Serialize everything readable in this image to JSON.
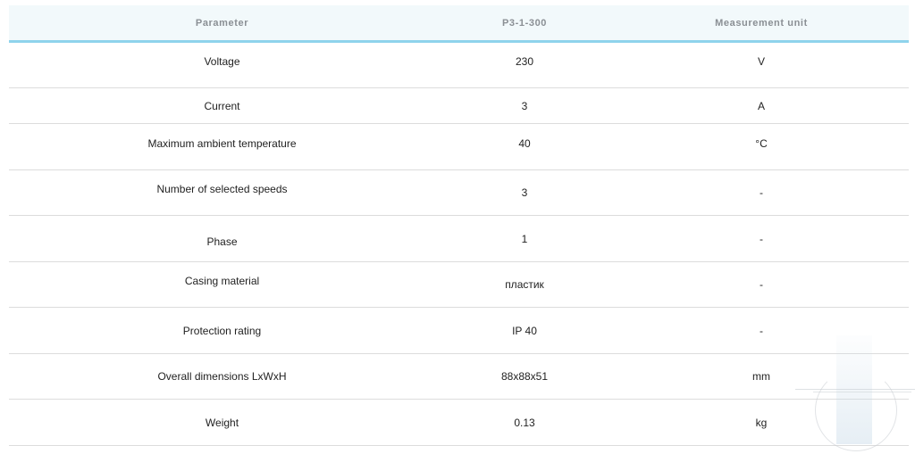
{
  "table": {
    "headers": {
      "parameter": "Parameter",
      "model": "P3-1-300",
      "unit": "Measurement unit"
    },
    "rows": [
      {
        "parameter": "Voltage",
        "value": "230",
        "unit": "V"
      },
      {
        "parameter": "Current",
        "value": "3",
        "unit": "A"
      },
      {
        "parameter": "Maximum ambient temperature",
        "value": "40",
        "unit": "°C"
      },
      {
        "parameter": "Number of selected speeds",
        "value": "3",
        "unit": "-"
      },
      {
        "parameter": "Phase",
        "value": "1",
        "unit": "-"
      },
      {
        "parameter": "Casing material",
        "value": "пластик",
        "unit": "-"
      },
      {
        "parameter": "Protection rating",
        "value": "IP 40",
        "unit": "-"
      },
      {
        "parameter": "Overall dimensions LxWxH",
        "value": "88x88x51",
        "unit": "mm"
      },
      {
        "parameter": "Weight",
        "value": "0.13",
        "unit": "kg"
      }
    ]
  },
  "colors": {
    "header_bg": "#f2f9fb",
    "header_border": "#8fd3ec",
    "header_text": "#8a8f94",
    "row_border": "#dcdcdc",
    "cell_text": "#222222"
  },
  "watermark": {
    "icon": "logo-watermark-icon"
  }
}
